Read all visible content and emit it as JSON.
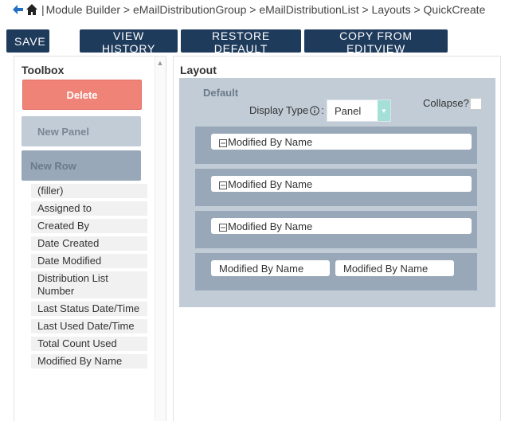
{
  "breadcrumb": {
    "separator": "|",
    "path": "Module Builder > eMailDistributionGroup > eMailDistributionList > Layouts > QuickCreate"
  },
  "toolbar": {
    "save": "SAVE",
    "view_history": "VIEW HISTORY",
    "restore_default": "RESTORE DEFAULT",
    "copy_from_editview": "COPY FROM EDITVIEW"
  },
  "toolbox": {
    "title": "Toolbox",
    "delete": "Delete",
    "new_panel": "New Panel",
    "new_row": "New Row",
    "fields": [
      "(filler)",
      "Assigned to",
      "Created By",
      "Date Created",
      "Date Modified",
      "Distribution List Number",
      "Last Status Date/Time",
      "Last Used Date/Time",
      "Total Count Used",
      "Modified By Name"
    ]
  },
  "layout": {
    "title": "Layout",
    "panel": {
      "title": "Default",
      "display_type_label": "Display Type",
      "display_type_colon": ":",
      "display_type_value": "Panel",
      "collapse_label": "Collapse?",
      "rows": [
        [
          "Modified By Name"
        ],
        [
          "Modified By Name"
        ],
        [
          "Modified By Name"
        ],
        [
          "Modified By Name",
          "Modified By Name"
        ]
      ]
    }
  },
  "icons": {
    "back": "back-arrow-icon",
    "home": "home-icon",
    "info": "info-icon",
    "minus": "minus-icon",
    "dropdown": "chevron-down-icon"
  },
  "colors": {
    "toolbar_button": "#1f3b5c",
    "delete_button": "#f08377",
    "panel_bg": "#c2ccd6",
    "row_bg": "#98a8b8",
    "select_arrow": "#a5e0d8",
    "breadcrumb_icon": "#1f6fc5"
  }
}
